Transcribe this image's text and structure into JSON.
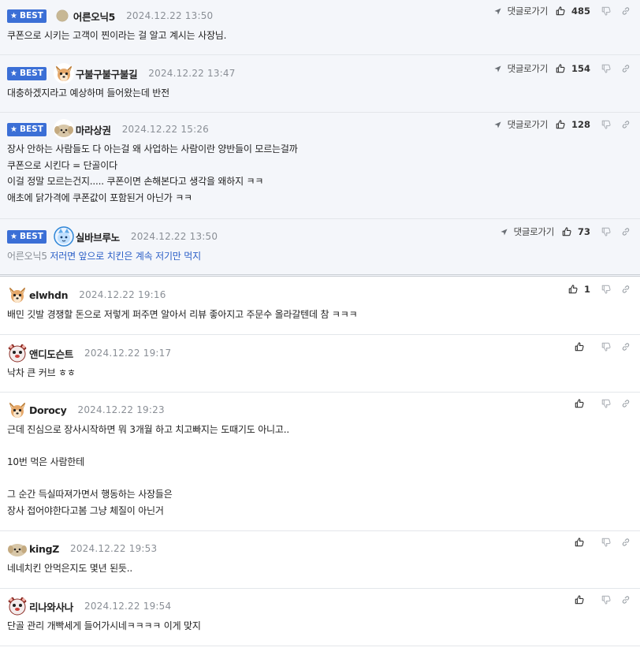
{
  "labels": {
    "best": "BEST",
    "reply_link": "댓글로가기"
  },
  "comments": [
    {
      "best": true,
      "avatar": "avatar-beige-dot",
      "nickname": "어른오닉5",
      "date": "2024.12.22 13:50",
      "likes": "485",
      "reply_link": true,
      "lines": [
        "쿠폰으로 시키는 고객이 찐이라는 걸 알고 계시는 사장님."
      ]
    },
    {
      "best": true,
      "avatar": "avatar-chihuahua",
      "nickname": "구불구불구불길",
      "date": "2024.12.22 13:47",
      "likes": "154",
      "reply_link": true,
      "lines": [
        "대충하겠지라고 예상하며 들어왔는데 반전"
      ]
    },
    {
      "best": true,
      "avatar": "avatar-puppy",
      "nickname": "마라상권",
      "date": "2024.12.22 15:26",
      "likes": "128",
      "reply_link": true,
      "lines": [
        "장사 안하는 사람들도 다 아는걸 왜 사업하는 사람이란 양반들이 모르는걸까",
        "쿠폰으로 시킨다 = 단골이다",
        "이걸 정말 모르는건지..... 쿠폰이면 손해본다고 생각을 왜하지 ㅋㅋ",
        "애초에 닭가격에 쿠폰값이 포함된거 아닌가 ㅋㅋ"
      ]
    },
    {
      "best": true,
      "avatar": "avatar-blue-cat",
      "nickname": "실바브루노",
      "date": "2024.12.22 13:50",
      "likes": "73",
      "reply_link": true,
      "mention": "어른오닉5",
      "lines": [
        "저러면 앞으로 치킨은 계속 저기만 먹지"
      ]
    },
    {
      "best": false,
      "avatar": "avatar-chihuahua",
      "nickname": "elwhdn",
      "date": "2024.12.22 19:16",
      "likes": "1",
      "reply_link": false,
      "lines": [
        "배민 깃발 경쟁할 돈으로 저렇게 퍼주면 알아서 리뷰 좋아지고 주문수 올라갈텐데 참 ㅋㅋㅋ"
      ]
    },
    {
      "best": false,
      "avatar": "avatar-bear",
      "nickname": "앤디도슨트",
      "date": "2024.12.22 19:17",
      "likes": "",
      "reply_link": false,
      "lines": [
        "낙차 큰 커브 ㅎㅎ"
      ]
    },
    {
      "best": false,
      "avatar": "avatar-chihuahua",
      "nickname": "Dorocy",
      "date": "2024.12.22 19:23",
      "likes": "",
      "reply_link": false,
      "lines": [
        "근데 진심으로 장사시작하면 뭐 3개월 하고 치고빠지는 도때기도 아니고..",
        "",
        "10번 먹은 사람한테",
        "",
        "그 순간 득실따져가면서 행동하는 사장들은",
        "장사 접어야한다고봄 그냥 체질이 아닌거"
      ]
    },
    {
      "best": false,
      "avatar": "avatar-puppy",
      "nickname": "kingZ",
      "date": "2024.12.22 19:53",
      "likes": "",
      "reply_link": false,
      "lines": [
        "네네치킨 안먹은지도 몇년 된듯.."
      ]
    },
    {
      "best": false,
      "avatar": "avatar-bear",
      "nickname": "리나와사나",
      "date": "2024.12.22 19:54",
      "likes": "",
      "reply_link": false,
      "lines": [
        "단골 관리 개빡세게 들어가시네ㅋㅋㅋㅋ 이게 맞지"
      ]
    }
  ]
}
